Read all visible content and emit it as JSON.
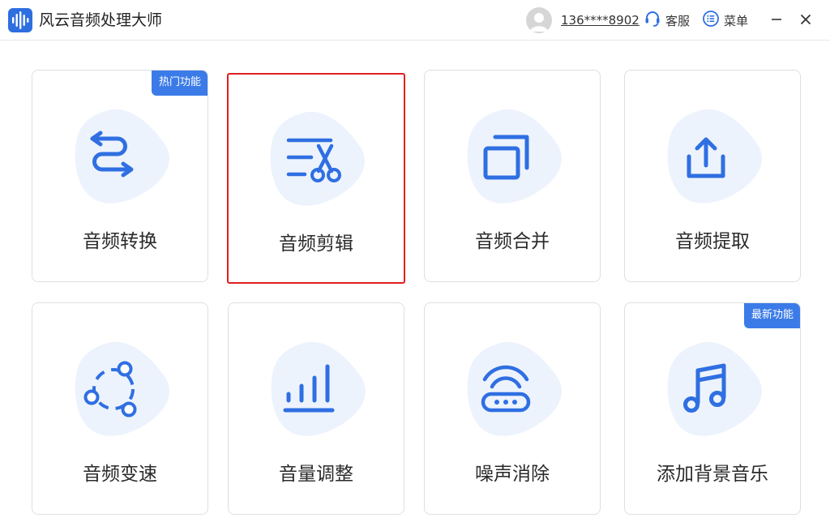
{
  "app": {
    "title": "风云音频处理大师"
  },
  "header": {
    "user_phone": "136****8902",
    "service_label": "客服",
    "menu_label": "菜单"
  },
  "colors": {
    "accent": "#3b7be8",
    "icon_stroke": "#2f6fe2",
    "blob": "#edf3fd",
    "selected_border": "#e02020"
  },
  "cards": [
    {
      "label": "音频转换",
      "badge": "热门功能",
      "icon": "convert-arrows-icon",
      "selected": false
    },
    {
      "label": "音频剪辑",
      "badge": "",
      "icon": "scissors-edit-icon",
      "selected": true
    },
    {
      "label": "音频合并",
      "badge": "",
      "icon": "merge-windows-icon",
      "selected": false
    },
    {
      "label": "音频提取",
      "badge": "",
      "icon": "extract-upload-icon",
      "selected": false
    },
    {
      "label": "音频变速",
      "badge": "",
      "icon": "speed-nodes-icon",
      "selected": false
    },
    {
      "label": "音量调整",
      "badge": "",
      "icon": "volume-bars-icon",
      "selected": false
    },
    {
      "label": "噪声消除",
      "badge": "",
      "icon": "noise-router-icon",
      "selected": false
    },
    {
      "label": "添加背景音乐",
      "badge": "最新功能",
      "icon": "music-note-icon",
      "selected": false
    }
  ]
}
